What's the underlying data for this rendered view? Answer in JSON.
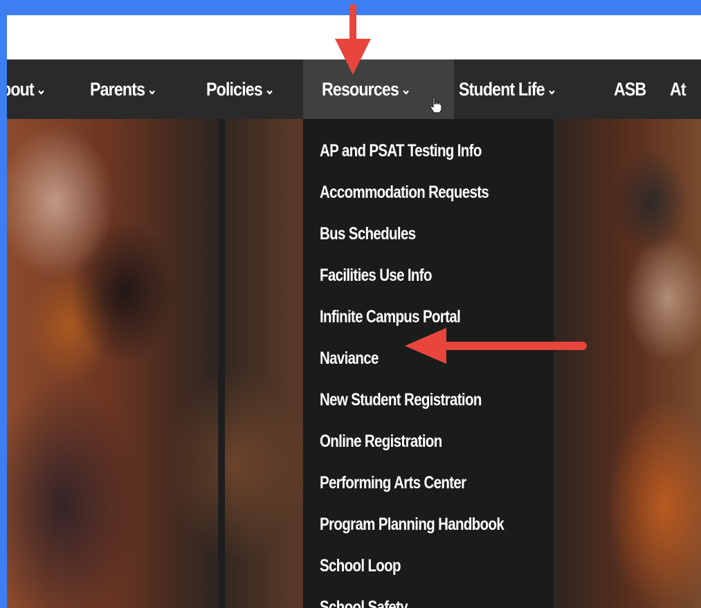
{
  "nav": {
    "items": [
      {
        "label": "bout",
        "caret": "⌄"
      },
      {
        "label": "Parents",
        "caret": "⌄"
      },
      {
        "label": "Policies",
        "caret": "⌄"
      },
      {
        "label": "Resources",
        "caret": "⌄"
      },
      {
        "label": "Student Life",
        "caret": "⌄"
      },
      {
        "label": "ASB",
        "caret": ""
      },
      {
        "label": "At",
        "caret": ""
      }
    ]
  },
  "dropdown": {
    "items": [
      "AP and PSAT Testing Info",
      "Accommodation Requests",
      "Bus Schedules",
      "Facilities Use Info",
      "Infinite Campus Portal",
      "Naviance",
      "New Student Registration",
      "Online Registration",
      "Performing Arts Center",
      "Program Planning Handbook",
      "School Loop",
      "School Safety"
    ]
  },
  "annotations": {
    "arrow_color": "#e8453c",
    "frame_color": "#3d7ff2"
  }
}
